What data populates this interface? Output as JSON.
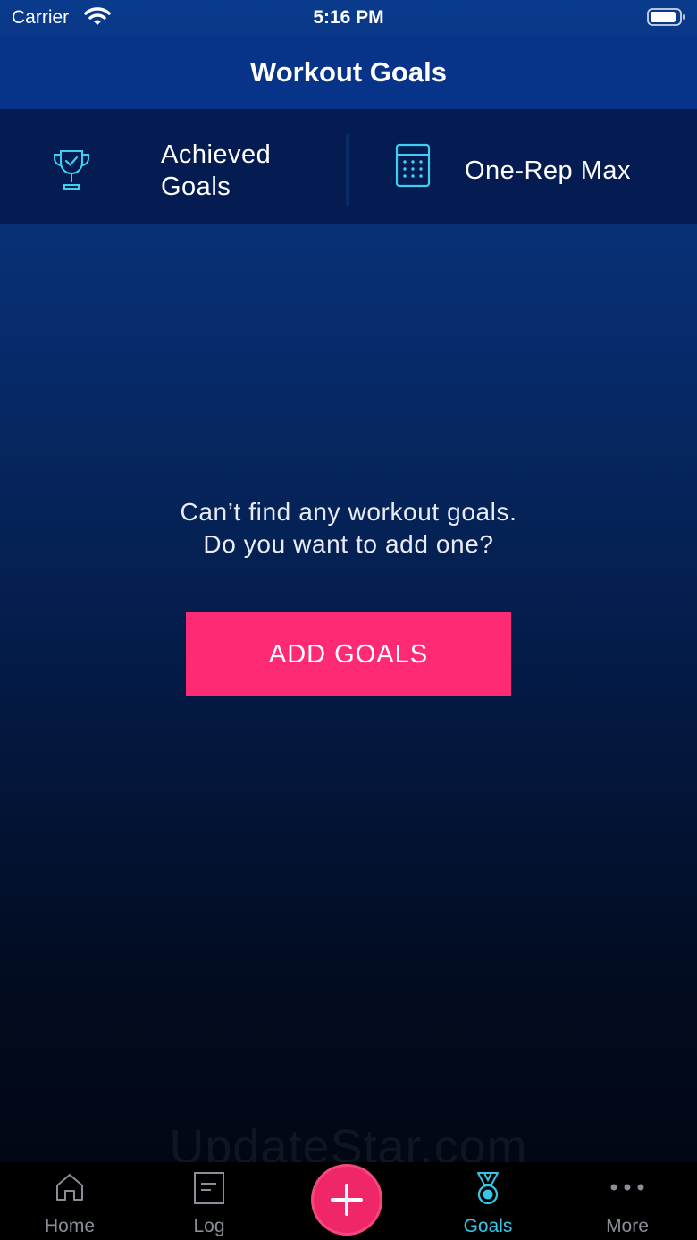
{
  "status_bar": {
    "carrier": "Carrier",
    "time": "5:16 PM"
  },
  "header": {
    "title": "Workout Goals"
  },
  "segments": [
    {
      "label": "Achieved Goals",
      "icon": "trophy-icon"
    },
    {
      "label": "One-Rep Max",
      "icon": "calculator-icon"
    }
  ],
  "empty_state": {
    "line1": "Can’t find any workout goals.",
    "line2": "Do you want to add one?",
    "button_label": "ADD GOALS"
  },
  "watermark": "UpdateStar.com",
  "tab_bar": {
    "active": "Goals",
    "tabs": [
      {
        "label": "Home",
        "icon": "home-icon"
      },
      {
        "label": "Log",
        "icon": "log-icon"
      },
      {
        "label": "",
        "icon": "plus-icon"
      },
      {
        "label": "Goals",
        "icon": "medal-icon"
      },
      {
        "label": "More",
        "icon": "more-icon"
      }
    ]
  },
  "colors": {
    "accent_pink": "#ff2a74",
    "active_tab": "#35c6e8",
    "icon_cyan": "#3fd0f0",
    "header_blue": "#073488",
    "segment_bg": "#041c52"
  }
}
